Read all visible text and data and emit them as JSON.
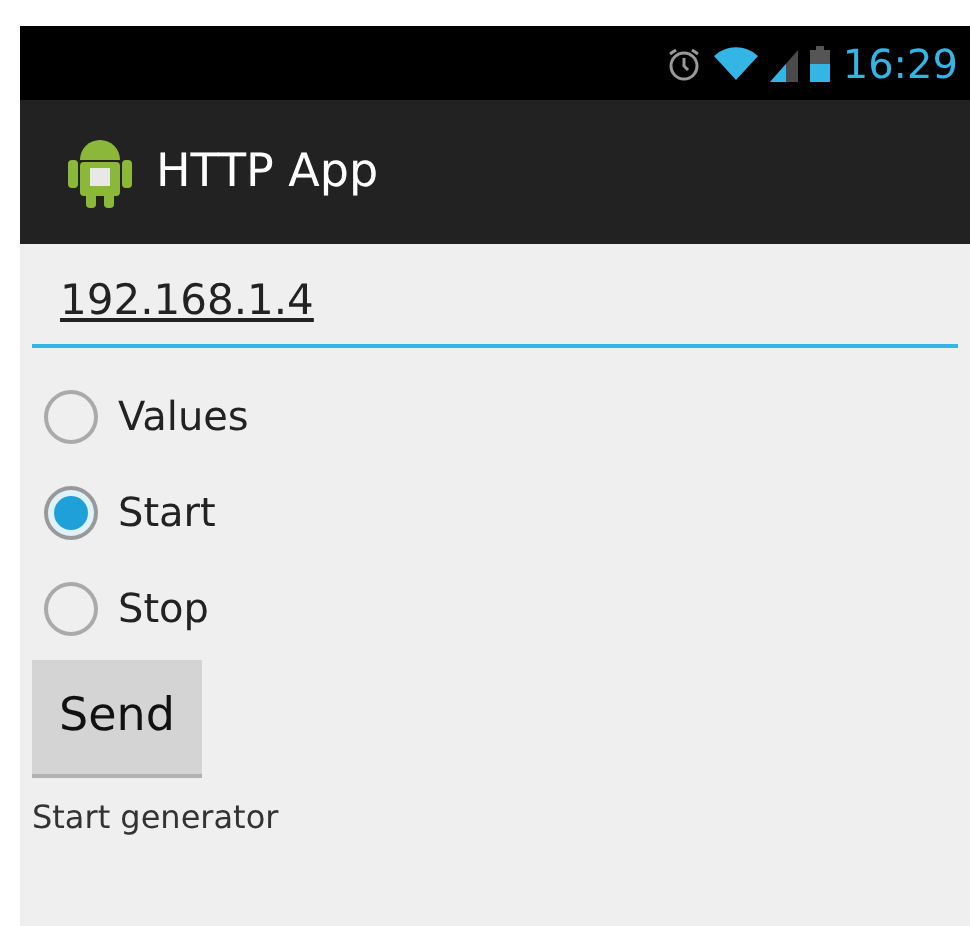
{
  "status_bar": {
    "time": "16:29"
  },
  "action_bar": {
    "title": "HTTP App"
  },
  "address_field": {
    "value": "192.168.1.4"
  },
  "options": [
    {
      "label": "Values",
      "selected": false
    },
    {
      "label": "Start",
      "selected": true
    },
    {
      "label": "Stop",
      "selected": false
    }
  ],
  "send_button": {
    "label": "Send"
  },
  "status_text": "Start generator"
}
